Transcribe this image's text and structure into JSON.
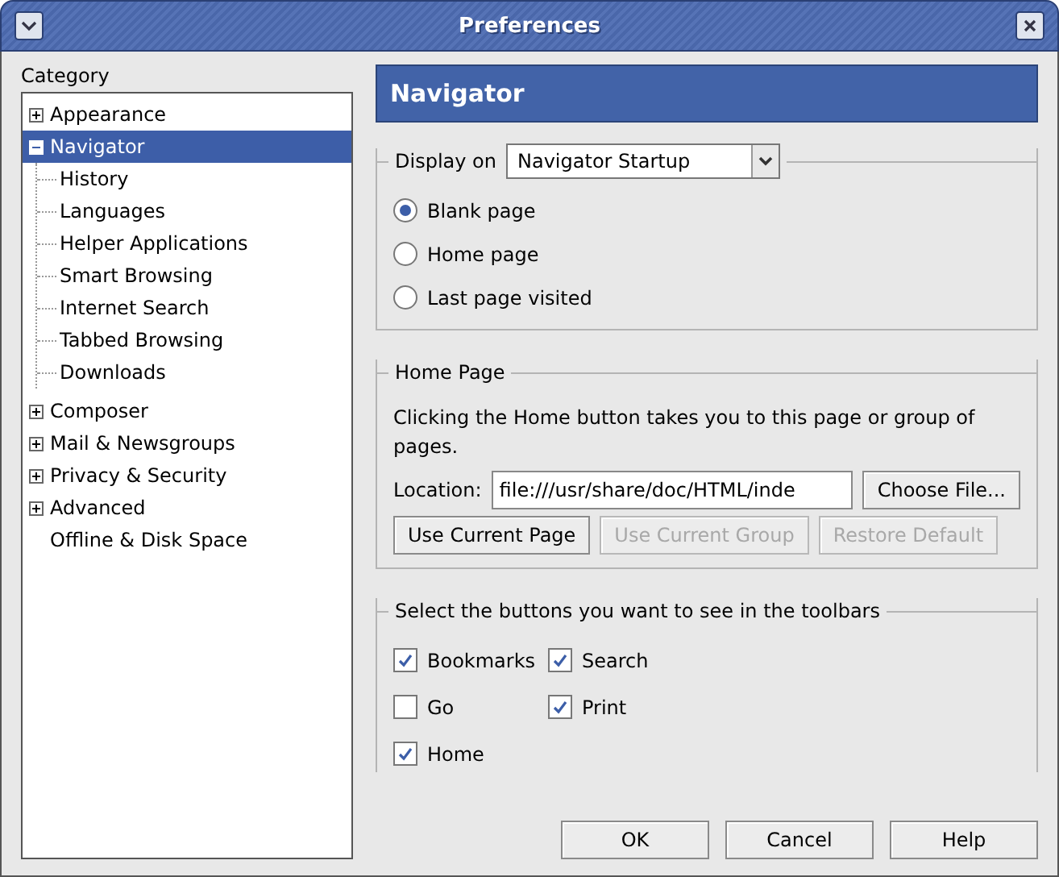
{
  "window": {
    "title": "Preferences"
  },
  "category": {
    "label": "Category",
    "items": [
      {
        "label": "Appearance",
        "expanded": false,
        "selected": false
      },
      {
        "label": "Navigator",
        "expanded": true,
        "selected": true,
        "children": [
          {
            "label": "History",
            "selected": false
          },
          {
            "label": "Languages",
            "selected": false
          },
          {
            "label": "Helper Applications",
            "selected": false
          },
          {
            "label": "Smart Browsing",
            "selected": false
          },
          {
            "label": "Internet Search",
            "selected": false
          },
          {
            "label": "Tabbed Browsing",
            "selected": false
          },
          {
            "label": "Downloads",
            "selected": false
          }
        ]
      },
      {
        "label": "Composer",
        "expanded": false,
        "selected": false
      },
      {
        "label": "Mail & Newsgroups",
        "expanded": false,
        "selected": false
      },
      {
        "label": "Privacy & Security",
        "expanded": false,
        "selected": false
      },
      {
        "label": "Advanced",
        "expanded": false,
        "selected": false
      },
      {
        "label": "Offline & Disk Space",
        "selected": false
      }
    ]
  },
  "panel": {
    "title": "Navigator",
    "display_on": {
      "label": "Display on",
      "value": "Navigator Startup",
      "options": [
        {
          "label": "Blank page",
          "selected": true
        },
        {
          "label": "Home page",
          "selected": false
        },
        {
          "label": "Last page visited",
          "selected": false
        }
      ]
    },
    "home_page": {
      "title": "Home Page",
      "description": "Clicking the Home button takes you to this page or group of pages.",
      "location_label": "Location:",
      "location_value": "file:///usr/share/doc/HTML/inde",
      "buttons": [
        {
          "label": "Choose File...",
          "disabled": false
        },
        {
          "label": "Use Current Page",
          "disabled": false
        },
        {
          "label": "Use Current Group",
          "disabled": true
        },
        {
          "label": "Restore Default",
          "disabled": true
        }
      ]
    },
    "toolbar_buttons": {
      "title": "Select the buttons you want to see in the toolbars",
      "items": [
        {
          "label": "Bookmarks",
          "checked": true
        },
        {
          "label": "Search",
          "checked": true
        },
        {
          "label": "Go",
          "checked": false
        },
        {
          "label": "Print",
          "checked": true
        },
        {
          "label": "Home",
          "checked": true
        }
      ]
    }
  },
  "buttons": [
    {
      "label": "OK"
    },
    {
      "label": "Cancel"
    },
    {
      "label": "Help"
    }
  ]
}
